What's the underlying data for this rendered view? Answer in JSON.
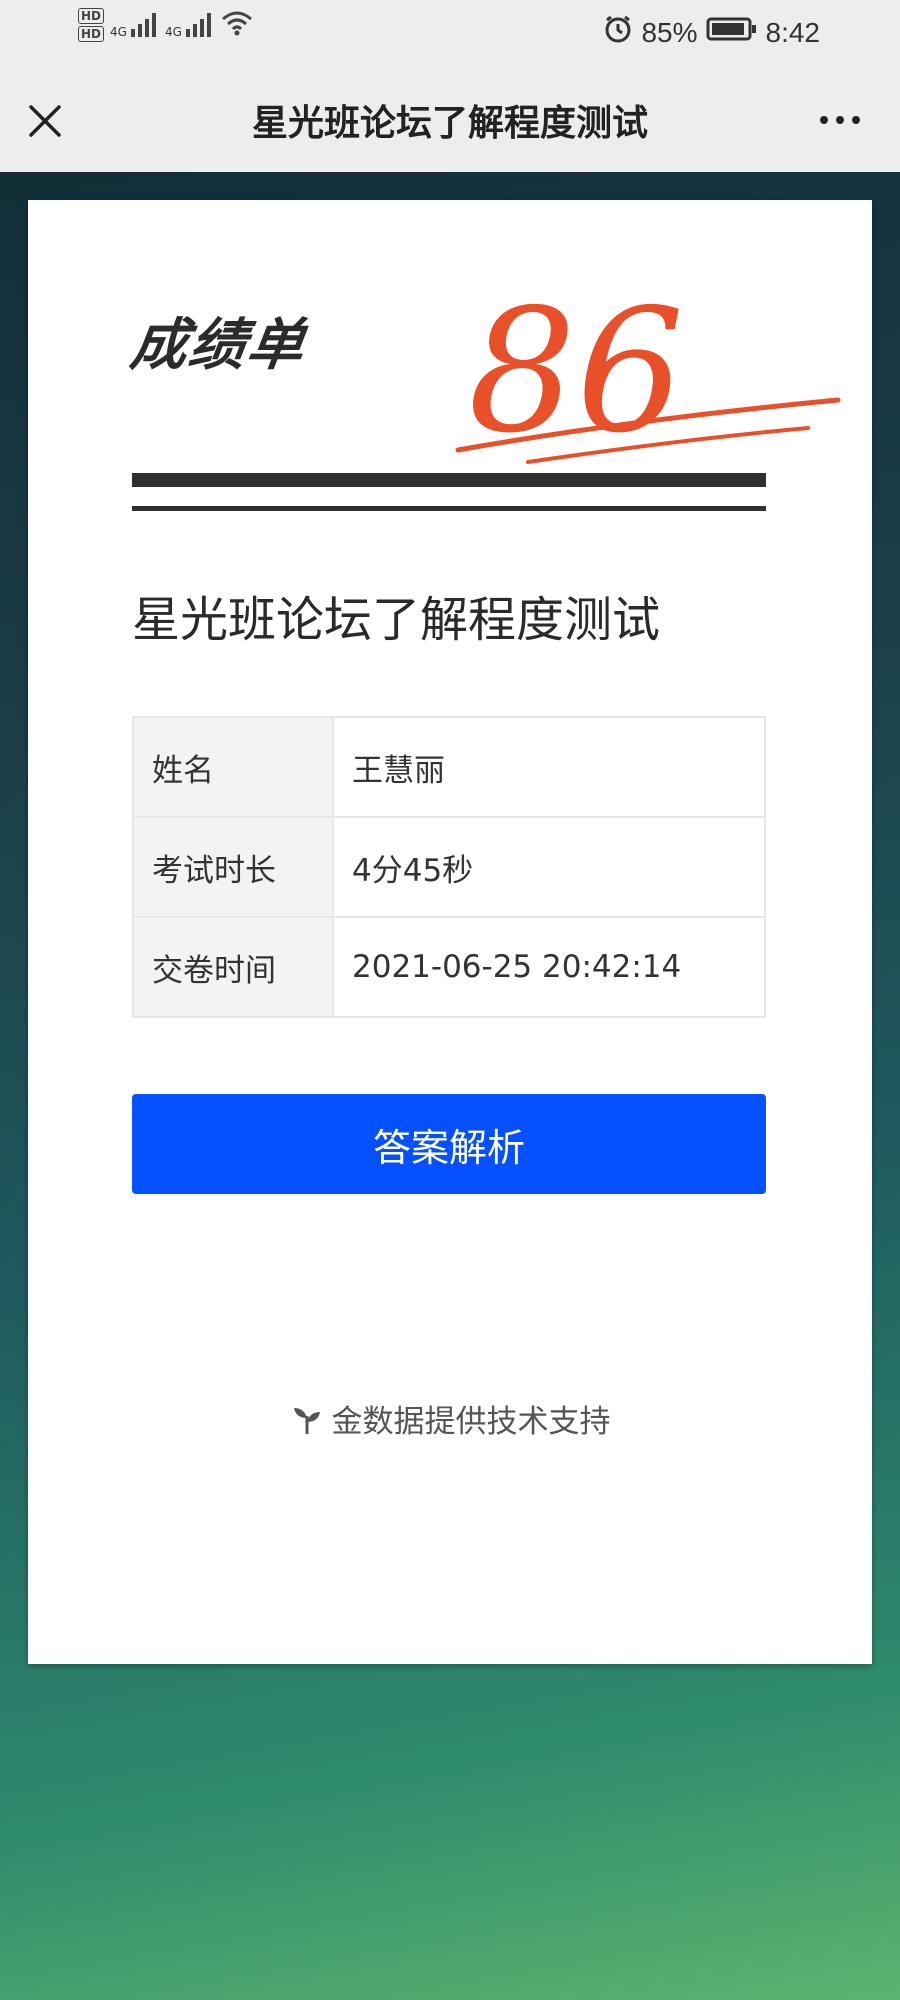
{
  "status_bar": {
    "hd1": "HD",
    "hd2": "HD",
    "signal1": "4G",
    "signal2": "4G",
    "battery": "85%",
    "time": "8:42"
  },
  "title_bar": {
    "title": "星光班论坛了解程度测试"
  },
  "card": {
    "report_label": "成绩单",
    "score": "86",
    "exam_title": "星光班论坛了解程度测试",
    "rows": [
      {
        "key": "姓名",
        "value": "王慧丽"
      },
      {
        "key": "考试时长",
        "value": "4分45秒"
      },
      {
        "key": "交卷时间",
        "value": "2021-06-25 20:42:14"
      }
    ],
    "answer_button": "答案解析",
    "footer": "金数据提供技术支持"
  },
  "colors": {
    "accent": "#0550ff",
    "score_red": "#e8502a",
    "chrome": "#ededed"
  }
}
